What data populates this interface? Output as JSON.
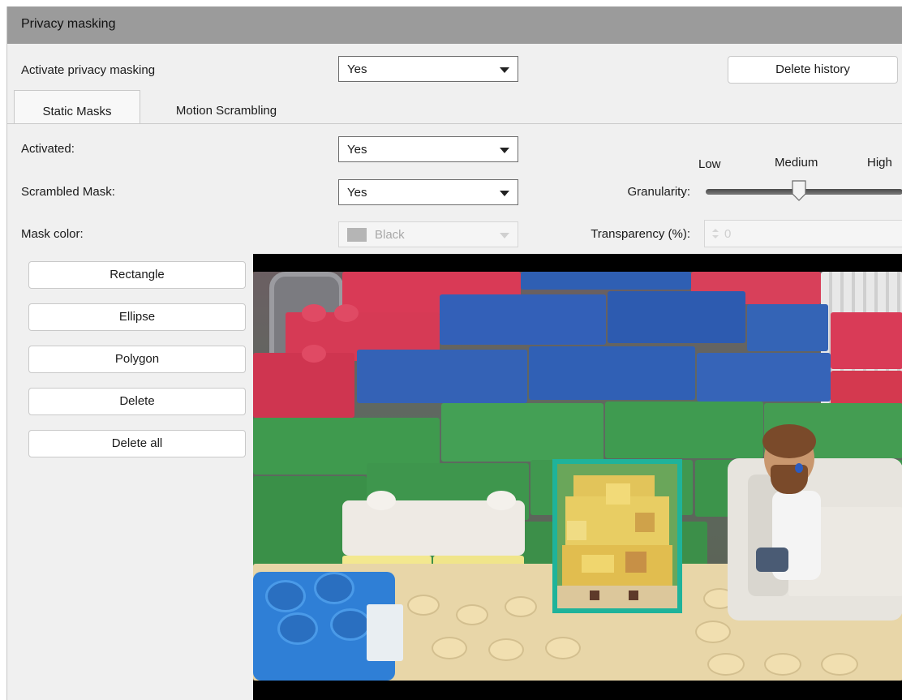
{
  "panel": {
    "title": "Privacy masking"
  },
  "activate": {
    "label": "Activate privacy masking",
    "value": "Yes"
  },
  "delete_history_label": "Delete history",
  "tabs": [
    {
      "label": "Static Masks",
      "active": true
    },
    {
      "label": "Motion Scrambling",
      "active": false
    }
  ],
  "activated": {
    "label": "Activated:",
    "value": "Yes"
  },
  "scrambled_mask": {
    "label": "Scrambled Mask:",
    "value": "Yes"
  },
  "mask_color": {
    "label": "Mask color:",
    "value": "Black",
    "enabled": false
  },
  "granularity": {
    "label": "Granularity:",
    "low": "Low",
    "medium": "Medium",
    "high": "High",
    "level": "Medium"
  },
  "transparency": {
    "label": "Transparency (%):",
    "value": "0",
    "enabled": false
  },
  "tools": [
    "Rectangle",
    "Ellipse",
    "Polygon",
    "Delete",
    "Delete all"
  ],
  "colors": {
    "header": "#9b9b9b",
    "panel": "#f0f0f0",
    "mask_border": "#1fb39a"
  },
  "video": {
    "selected_mask_shape": "rectangle",
    "mask_style": "scrambled"
  }
}
